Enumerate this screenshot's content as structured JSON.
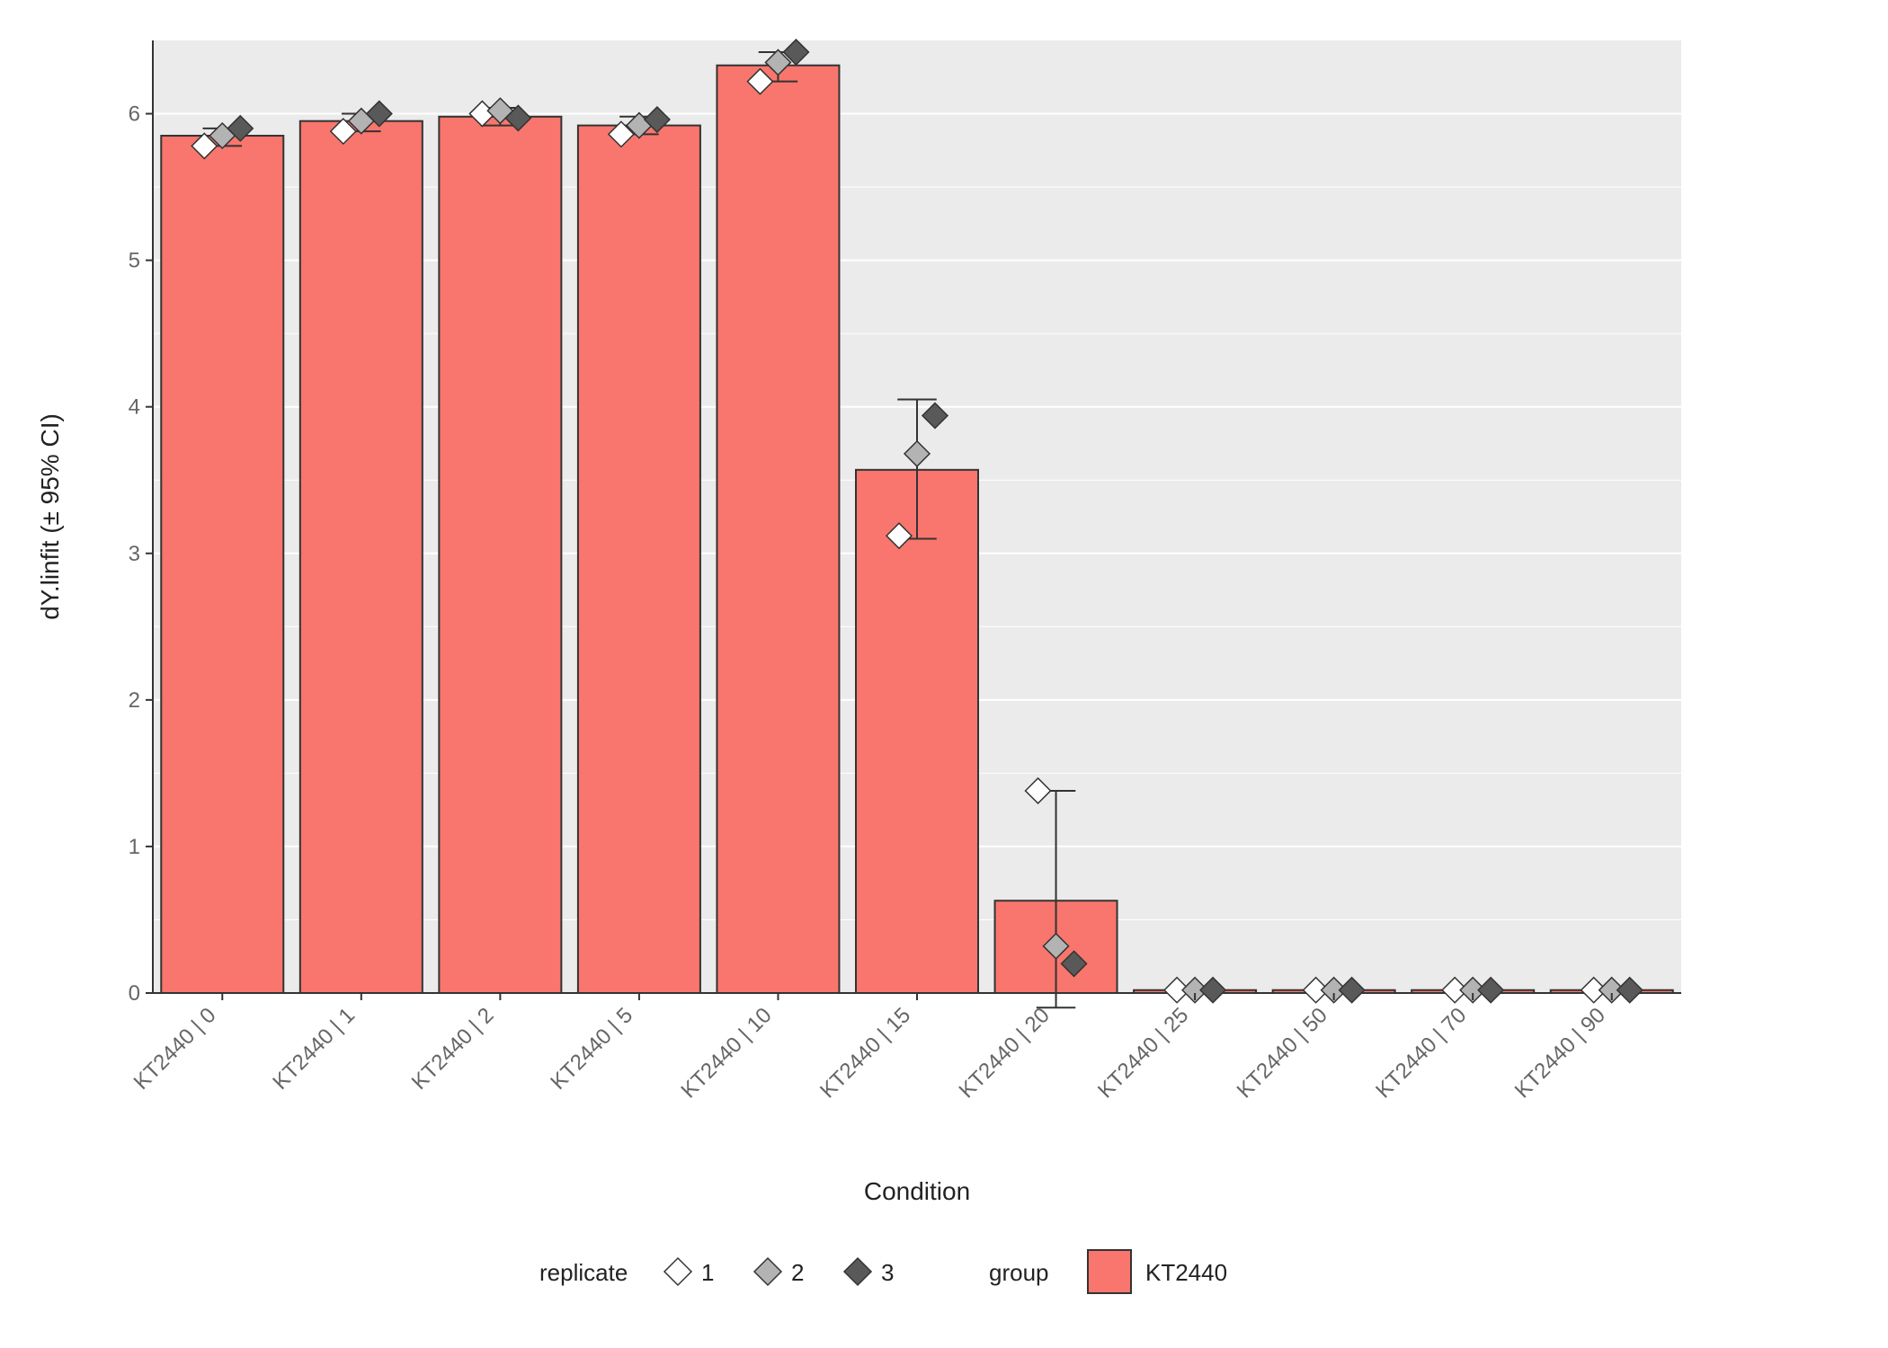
{
  "chart_data": {
    "type": "bar",
    "title": "",
    "xlabel": "Condition",
    "ylabel": "dY.linfit (± 95% CI)",
    "ylim": [
      0,
      6.5
    ],
    "yticks": [
      0,
      1,
      2,
      3,
      4,
      5,
      6
    ],
    "yminor": [
      0.5,
      1.5,
      2.5,
      3.5,
      4.5,
      5.5
    ],
    "categories": [
      "KT2440 | 0",
      "KT2440 | 1",
      "KT2440 | 2",
      "KT2440 | 5",
      "KT2440 | 10",
      "KT2440 | 15",
      "KT2440 | 20",
      "KT2440 | 25",
      "KT2440 | 50",
      "KT2440 | 70",
      "KT2440 | 90"
    ],
    "values": [
      5.85,
      5.95,
      5.98,
      5.92,
      6.33,
      3.57,
      0.63,
      0.02,
      0.02,
      0.02,
      0.02
    ],
    "ci_low": [
      5.78,
      5.88,
      5.92,
      5.86,
      6.22,
      3.1,
      -0.1,
      0.0,
      0.0,
      0.0,
      0.0
    ],
    "ci_high": [
      5.9,
      6.0,
      6.04,
      5.98,
      6.42,
      4.05,
      1.38,
      0.04,
      0.04,
      0.04,
      0.04
    ],
    "replicates": {
      "1": [
        5.78,
        5.88,
        6.0,
        5.86,
        6.22,
        3.12,
        1.38,
        0.02,
        0.02,
        0.02,
        0.02
      ],
      "2": [
        5.85,
        5.95,
        6.02,
        5.92,
        6.35,
        3.68,
        0.32,
        0.02,
        0.02,
        0.02,
        0.02
      ],
      "3": [
        5.9,
        6.0,
        5.97,
        5.96,
        6.42,
        3.94,
        0.2,
        0.02,
        0.02,
        0.02,
        0.02
      ]
    },
    "replicate_colors": {
      "1": "#ffffff",
      "2": "#b3b3b3",
      "3": "#595959"
    },
    "bar_fill": "#f8766d",
    "group_name": "KT2440",
    "legend": {
      "replicate_title": "replicate",
      "replicate_levels": [
        "1",
        "2",
        "3"
      ],
      "group_title": "group",
      "group_levels": [
        "KT2440"
      ]
    }
  }
}
